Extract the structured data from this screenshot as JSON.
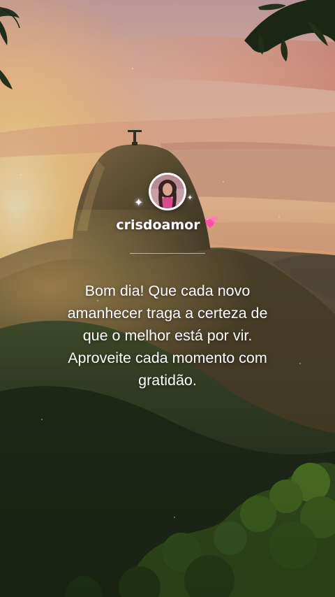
{
  "profile": {
    "username": "crisdoamor",
    "avatar_icon": "profile-photo",
    "heart_icon": "pink-heart-icon",
    "heart_color": "#ff5fb0"
  },
  "post": {
    "message": "Bom dia! Que cada novo amanhecer traga a certeza de que o melhor está por vir. Aproveite cada momento com gratidão."
  },
  "colors": {
    "sky_top": "#d9a9a4",
    "sun_glow": "#ffd88a",
    "mountain": "#3d4a2f",
    "text": "#ffffff"
  }
}
